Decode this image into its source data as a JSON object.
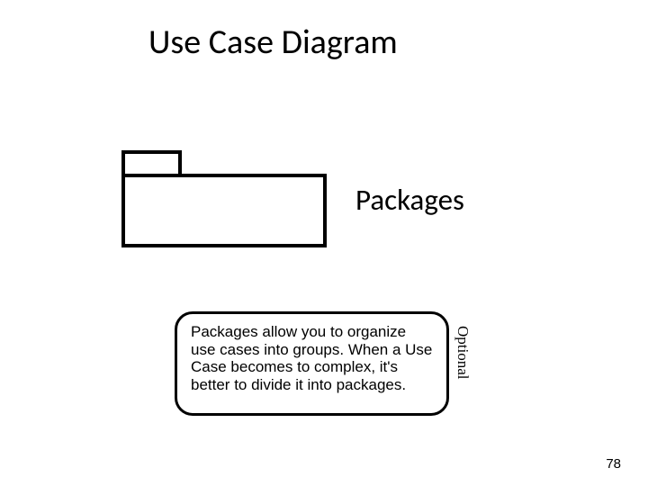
{
  "title": "Use Case Diagram",
  "subtitle": "Packages",
  "description": "Packages allow you to organize use cases into groups. When a Use Case becomes to complex, it's better to divide it into packages.",
  "side_label": "Optional",
  "page_number": "78"
}
